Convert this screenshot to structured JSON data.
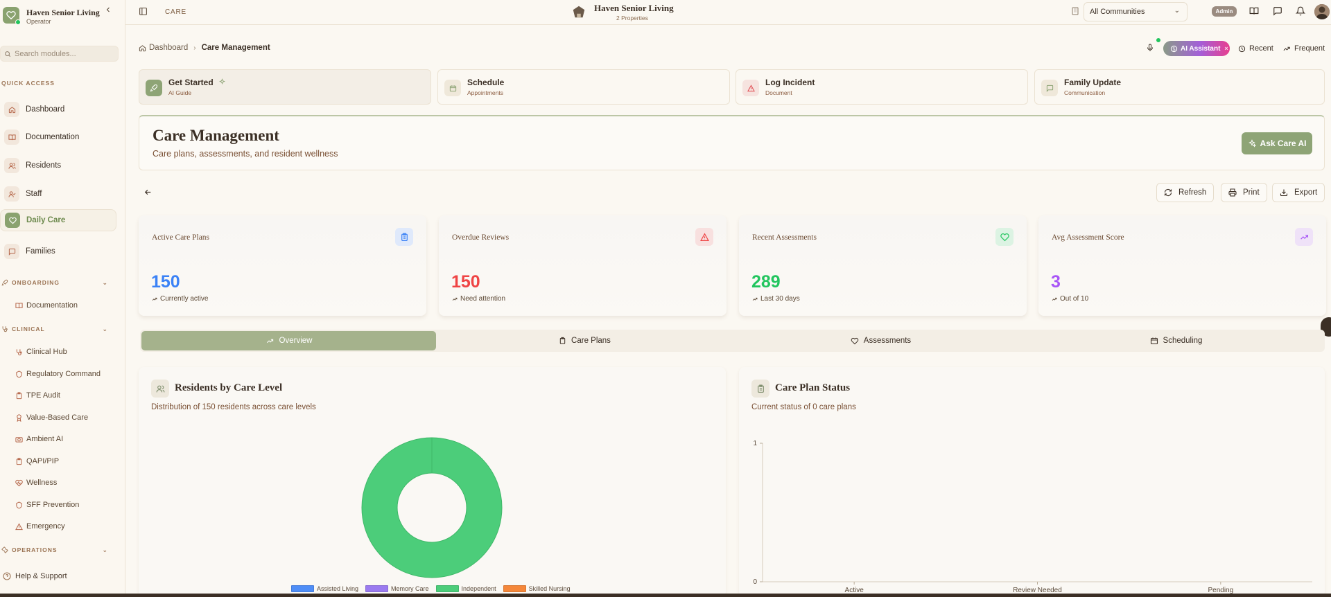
{
  "app": {
    "name": "Haven Senior Living",
    "role": "Operator",
    "module": "CARE",
    "center_name": "Haven Senior Living",
    "center_properties": "2 Properties"
  },
  "search": {
    "placeholder": "Search modules..."
  },
  "sidebar": {
    "quick_access_label": "QUICK ACCESS",
    "quick_access": [
      {
        "label": "Dashboard",
        "icon": "home-icon"
      },
      {
        "label": "Documentation",
        "icon": "book-icon"
      },
      {
        "label": "Residents",
        "icon": "users-icon"
      },
      {
        "label": "Staff",
        "icon": "user-check-icon"
      },
      {
        "label": "Daily Care",
        "icon": "heart-icon",
        "active": true
      },
      {
        "label": "Families",
        "icon": "message-icon"
      }
    ],
    "onboarding_label": "ONBOARDING",
    "onboarding": [
      {
        "label": "Documentation",
        "icon": "book-icon"
      }
    ],
    "clinical_label": "CLINICAL",
    "clinical": [
      {
        "label": "Clinical Hub",
        "icon": "stethoscope-icon"
      },
      {
        "label": "Regulatory Command",
        "icon": "shield-icon"
      },
      {
        "label": "TPE Audit",
        "icon": "clipboard-icon"
      },
      {
        "label": "Value-Based Care",
        "icon": "award-icon"
      },
      {
        "label": "Ambient AI",
        "icon": "camera-icon"
      },
      {
        "label": "QAPI/PIP",
        "icon": "clipboard-icon"
      },
      {
        "label": "Wellness",
        "icon": "heart-pulse-icon"
      },
      {
        "label": "SFF Prevention",
        "icon": "shield-icon"
      },
      {
        "label": "Emergency",
        "icon": "alert-triangle-icon"
      }
    ],
    "operations_label": "OPERATIONS",
    "help": "Help & Support"
  },
  "topbar": {
    "community_select": "All Communities",
    "admin_badge": "Admin"
  },
  "breadcrumb": {
    "root": "Dashboard",
    "current": "Care Management"
  },
  "header_actions": {
    "ai_assistant": "AI Assistant",
    "recent": "Recent",
    "frequent": "Frequent"
  },
  "quick_actions": [
    {
      "title": "Get Started",
      "subtitle": "AI Guide"
    },
    {
      "title": "Schedule",
      "subtitle": "Appointments"
    },
    {
      "title": "Log Incident",
      "subtitle": "Document"
    },
    {
      "title": "Family Update",
      "subtitle": "Communication"
    }
  ],
  "page": {
    "title": "Care Management",
    "subtitle": "Care plans, assessments, and resident wellness",
    "ask_ai": "Ask Care AI"
  },
  "actions": {
    "refresh": "Refresh",
    "print": "Print",
    "export": "Export"
  },
  "stats": [
    {
      "label": "Active Care Plans",
      "value": "150",
      "sub": "Currently active",
      "color": "#3b82f6"
    },
    {
      "label": "Overdue Reviews",
      "value": "150",
      "sub": "Need attention",
      "color": "#ef4444"
    },
    {
      "label": "Recent Assessments",
      "value": "289",
      "sub": "Last 30 days",
      "color": "#22c55e"
    },
    {
      "label": "Avg Assessment Score",
      "value": "3",
      "sub": "Out of 10",
      "color": "#a855f7"
    }
  ],
  "tabs": [
    {
      "label": "Overview",
      "active": true
    },
    {
      "label": "Care Plans"
    },
    {
      "label": "Assessments"
    },
    {
      "label": "Scheduling"
    }
  ],
  "cards": {
    "residents": {
      "title": "Residents by Care Level",
      "subtitle": "Distribution of 150 residents across care levels"
    },
    "careplan": {
      "title": "Care Plan Status",
      "subtitle": "Current status of 0 care plans"
    }
  },
  "chart_data": [
    {
      "type": "pie",
      "categories": [
        "Assisted Living",
        "Memory Care",
        "Independent",
        "Skilled Nursing"
      ],
      "values": [
        0,
        0,
        150,
        0
      ],
      "colors": [
        "#4f8ef7",
        "#9b7bf0",
        "#4ccd7a",
        "#f5873a"
      ],
      "legend": "bottom"
    },
    {
      "type": "bar",
      "categories": [
        "Active",
        "Review Needed",
        "Pending"
      ],
      "values": [
        0,
        0,
        0
      ],
      "ylim": [
        0,
        1
      ],
      "yticks": [
        "0",
        "1"
      ]
    }
  ]
}
